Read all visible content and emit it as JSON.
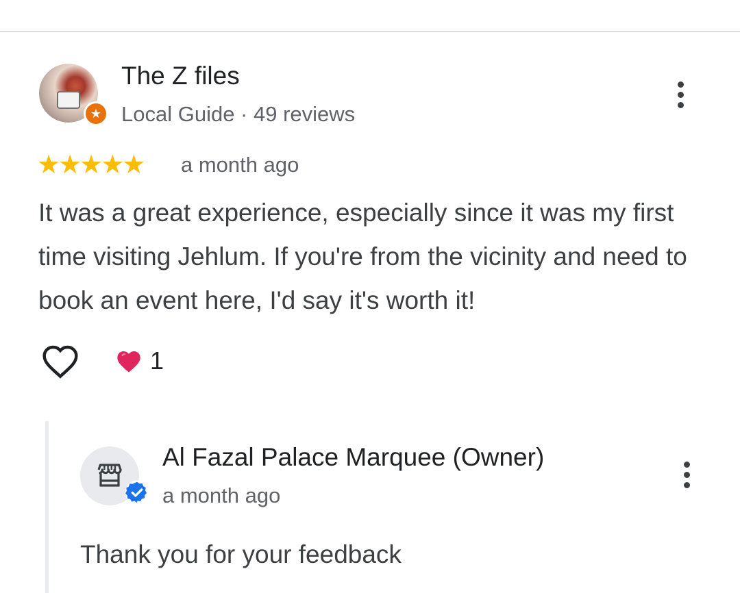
{
  "review": {
    "author_name": "The Z files",
    "author_meta": "Local Guide · 49 reviews",
    "rating_stars": "★★★★★",
    "rating": 5,
    "date": "a month ago",
    "text": "It was a great experience, especially since it was my first time visiting Jehlum. If you're from the vicinity and need to book an event here, I'd say it's worth it!",
    "reaction_count": "1"
  },
  "owner_reply": {
    "name": "Al Fazal Palace Marquee (Owner)",
    "date": "a month ago",
    "text": "Thank you for your feedback"
  },
  "colors": {
    "star": "#fbbc04",
    "local_guide_badge": "#e8710a",
    "verified_badge": "#1a73e8",
    "heart": "#e0245e",
    "divider": "#dadce0"
  },
  "icons": {
    "like": "heart-outline-icon",
    "reaction": "red-heart-icon",
    "more": "more-vert-icon",
    "store": "storefront-icon",
    "verified": "verified-check-icon",
    "guide": "local-guide-star-icon"
  }
}
